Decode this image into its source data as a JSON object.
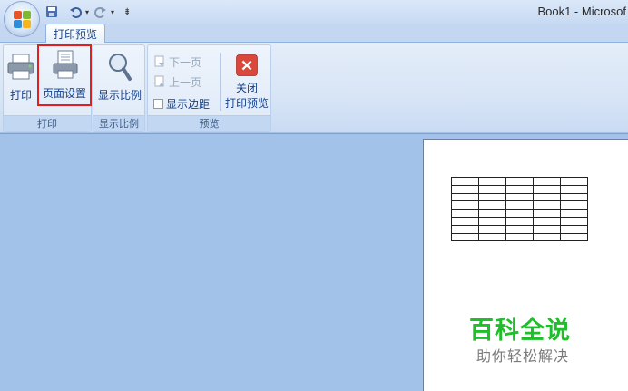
{
  "window": {
    "title": "Book1 - Microsof"
  },
  "tabs": [
    {
      "label": "打印预览",
      "active": true
    }
  ],
  "ribbon": {
    "groups": {
      "print": {
        "label": "打印",
        "buttons": {
          "print": "打印",
          "page_setup": "页面设置"
        }
      },
      "zoom": {
        "label": "显示比例",
        "buttons": {
          "zoom": "显示比例"
        }
      },
      "preview": {
        "label": "预览",
        "next_page": "下一页",
        "prev_page": "上一页",
        "show_margins": "显示边距",
        "close_line1": "关闭",
        "close_line2": "打印预览"
      }
    }
  },
  "preview_page": {
    "table": {
      "rows": 8,
      "cols": 5
    },
    "watermark": {
      "title": "百科全说",
      "subtitle": "助你轻松解决"
    }
  },
  "colors": {
    "highlight": "#e02020",
    "watermark_green": "#1fbf2b",
    "workspace": "#a3c2e9"
  },
  "icons": [
    "office-button-icon",
    "save-icon",
    "undo-icon",
    "redo-icon",
    "customize-qat-icon",
    "printer-icon",
    "page-setup-icon",
    "zoom-magnifier-icon",
    "next-page-icon",
    "prev-page-icon",
    "close-preview-icon"
  ]
}
